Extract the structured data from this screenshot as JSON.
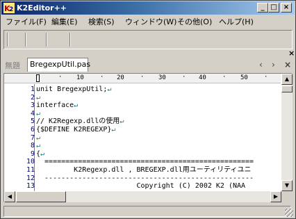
{
  "window": {
    "title": "K2Editor++",
    "controls": {
      "minimize": "_",
      "maximize": "□",
      "close": "×"
    }
  },
  "menu": [
    {
      "label": "ファイル(F)"
    },
    {
      "label": "編集(E)"
    },
    {
      "label": "検索(S)"
    },
    {
      "label": "ウィンドウ(W)"
    },
    {
      "label": "その他(O)"
    },
    {
      "label": "ヘルプ(H)"
    }
  ],
  "tabs": {
    "blank_label": "無題",
    "active_label": "BregexpUtil.pas",
    "nav_prev": "‹",
    "nav_next": "›",
    "close": "×"
  },
  "ruler": {
    "labels": [
      "10",
      "20",
      "30",
      "40",
      "50"
    ]
  },
  "editor": {
    "lines": [
      {
        "n": "1",
        "text": "unit BregexpUtil;",
        "eol": "↵"
      },
      {
        "n": "2",
        "text": "",
        "eol": "↵"
      },
      {
        "n": "3",
        "text": "interface",
        "eol": "↵"
      },
      {
        "n": "4",
        "text": "",
        "eol": "↵"
      },
      {
        "n": "5",
        "text": "// K2Regexp.dllの使用",
        "eol": "↵"
      },
      {
        "n": "6",
        "text": "{$DEFINE K2REGEXP}",
        "eol": "↵"
      },
      {
        "n": "7",
        "text": "",
        "eol": "↵"
      },
      {
        "n": "8",
        "text": "",
        "eol": "↵"
      },
      {
        "n": "9",
        "text": "{",
        "eol": "↵"
      },
      {
        "n": "10",
        "text": "  ==================================================",
        "eol": ""
      },
      {
        "n": "11",
        "text": "         K2Regexp.dll , BREGEXP.dll用ユーティリティユニ",
        "eol": ""
      },
      {
        "n": "12",
        "text": "  --------------------------------------------------",
        "eol": ""
      },
      {
        "n": "13",
        "text": "                        Copyright (C) 2002 K2 (NAA",
        "eol": ""
      }
    ]
  },
  "scroll": {
    "up": "▲",
    "down": "▼",
    "left": "◀",
    "right": "▶"
  },
  "colors": {
    "title_gradient_start": "#0a246a",
    "title_gradient_end": "#a6caf0",
    "line_number": "#000080",
    "eol_mark": "#008080"
  }
}
